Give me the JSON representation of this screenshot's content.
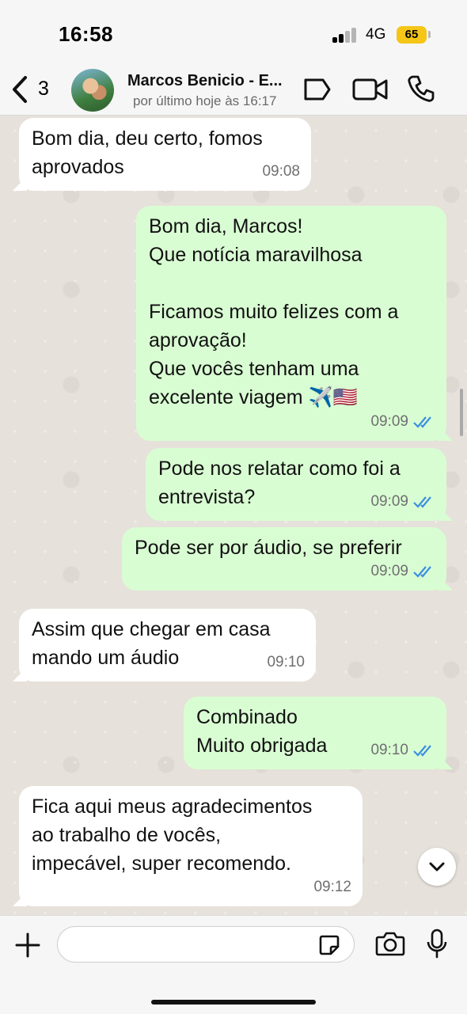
{
  "status_bar": {
    "time": "16:58",
    "network": "4G",
    "battery": "65"
  },
  "header": {
    "back_count": "3",
    "contact_name": "Marcos Benicio - E...",
    "last_seen": "por último hoje às 16:17",
    "icons": [
      "chevron-left-icon",
      "tag-icon",
      "video-call-icon",
      "phone-icon"
    ]
  },
  "messages": [
    {
      "direction": "in",
      "text": "Bom dia, deu certo, fomos\naprovados",
      "time": "09:08"
    },
    {
      "direction": "out",
      "text": "Bom dia, Marcos!\nQue notícia maravilhosa\n\nFicamos muito felizes com a\naprovação!\nQue vocês tenham uma\nexcelente viagem ✈️🇺🇸",
      "time": "09:09",
      "read": true
    },
    {
      "direction": "out",
      "text": "Pode nos relatar como foi a\nentrevista?",
      "time": "09:09",
      "read": true
    },
    {
      "direction": "out",
      "text": "Pode ser por áudio, se preferir",
      "time": "09:09",
      "read": true
    },
    {
      "direction": "in",
      "text": "Assim que chegar em casa\nmando um áudio",
      "time": "09:10"
    },
    {
      "direction": "out",
      "text": "Combinado\nMuito obrigada",
      "time": "09:10",
      "read": true
    },
    {
      "direction": "in",
      "text": "Fica aqui meus agradecimentos\nao trabalho de vocês,\nimpecável, super recomendo.",
      "time": "09:12"
    }
  ],
  "input_bar": {
    "placeholder": "",
    "icons": [
      "plus-icon",
      "sticker-icon",
      "camera-icon",
      "mic-icon"
    ]
  },
  "colors": {
    "incoming_bubble": "#ffffff",
    "outgoing_bubble": "#d9fdd3",
    "read_ticks": "#3a8fe0",
    "chat_background": "#e6e1da"
  }
}
